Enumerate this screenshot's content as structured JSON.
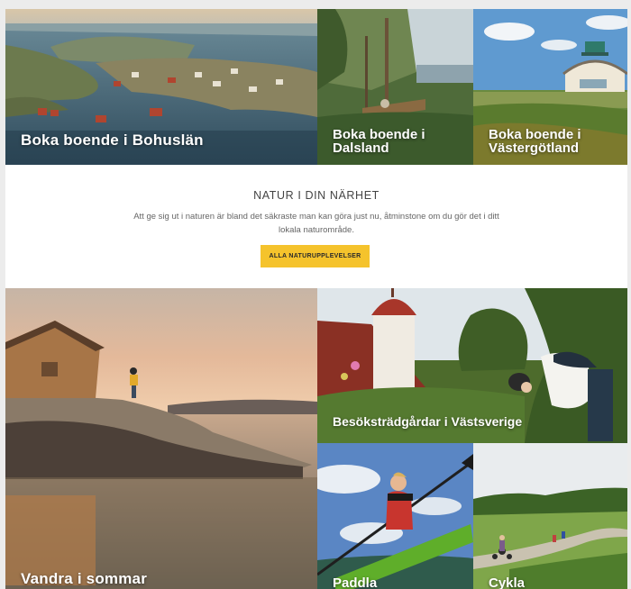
{
  "tiles": {
    "bohuslan": "Boka boende i Bohuslän",
    "dalsland": "Boka boende i Dalsland",
    "vastergotland": "Boka boende i Västergötland",
    "vandra": "Vandra i sommar",
    "tradgardar": "Besöksträdgårdar i Västsverige",
    "paddla": "Paddla",
    "cykla": "Cykla"
  },
  "nature": {
    "heading": "NATUR I DIN NÄRHET",
    "text": "Att ge sig ut i naturen är bland det säkraste man kan göra just nu, åtminstone om du gör det i ditt lokala naturområde.",
    "button": "ALLA NATURUPPLEVELSER"
  },
  "colors": {
    "accent": "#f5c32c",
    "page_background": "#ececec"
  }
}
